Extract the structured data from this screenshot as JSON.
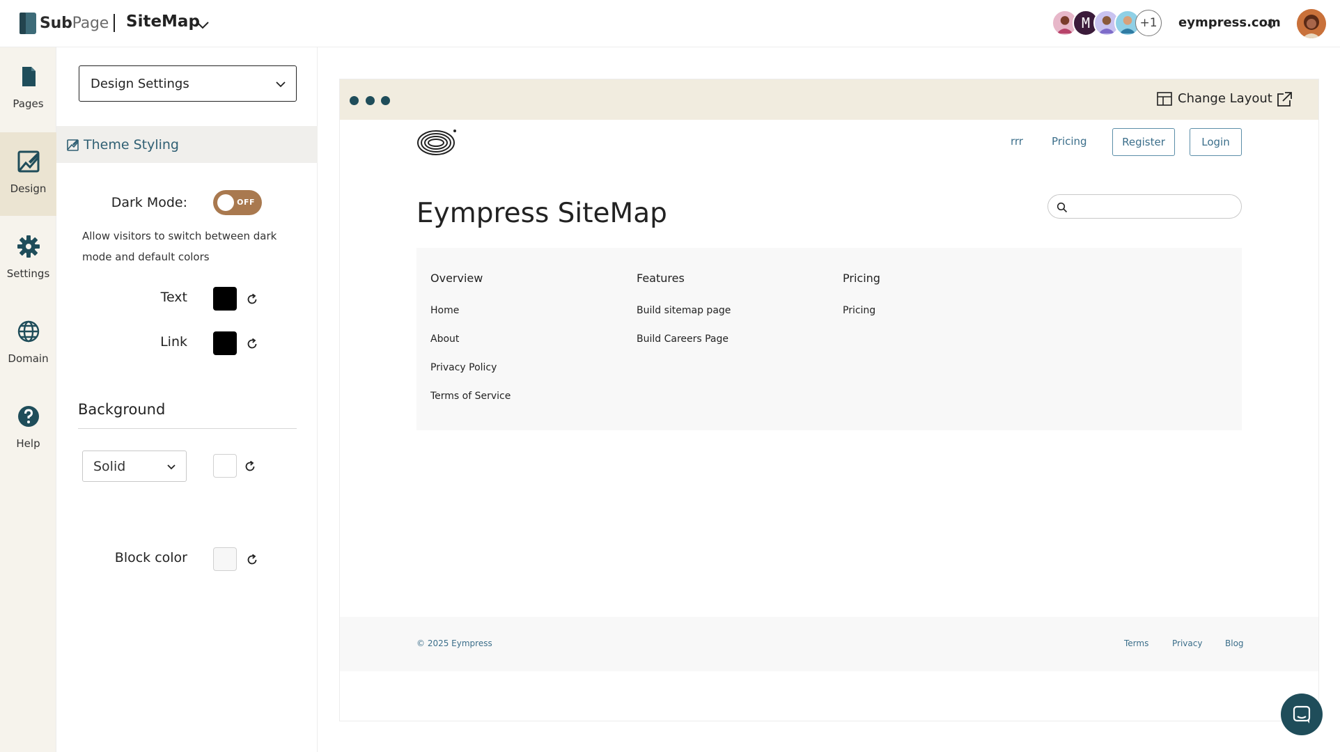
{
  "header": {
    "brand_bold": "Sub",
    "brand_rest": "Page",
    "site_name": "SiteMap",
    "avatars_more": "+1",
    "avatar_m_letter": "M",
    "domain": "eympress.com"
  },
  "leftnav": {
    "items": [
      {
        "label": "Pages",
        "icon": "page-icon"
      },
      {
        "label": "Design",
        "icon": "design-icon"
      },
      {
        "label": "Settings",
        "icon": "gear-icon"
      },
      {
        "label": "Domain",
        "icon": "globe-icon"
      },
      {
        "label": "Help",
        "icon": "help-icon"
      }
    ],
    "active": "Design"
  },
  "panel": {
    "select_value": "Design Settings",
    "section_title": "Theme Styling",
    "dark_mode_label": "Dark Mode:",
    "dark_mode_state": "OFF",
    "dark_mode_help": "Allow visitors to switch between dark mode and default colors",
    "text_label": "Text",
    "text_color": "#000000",
    "link_label": "Link",
    "link_color": "#000000",
    "background_heading": "Background",
    "background_type": "Solid",
    "background_color": "#ffffff",
    "block_color_label": "Block color",
    "block_color": "#f7f7f7"
  },
  "preview": {
    "change_layout": "Change Layout",
    "site": {
      "nav": [
        "rrr",
        "Pricing"
      ],
      "register": "Register",
      "login": "Login",
      "title": "Eympress SiteMap",
      "columns": [
        {
          "title": "Overview",
          "links": [
            "Home",
            "About",
            "Privacy Policy",
            "Terms of Service"
          ]
        },
        {
          "title": "Features",
          "links": [
            "Build sitemap page",
            "Build Careers Page"
          ]
        },
        {
          "title": "Pricing",
          "links": [
            "Pricing"
          ]
        }
      ],
      "footer": {
        "copyright": "© 2025 Eympress",
        "links": [
          "Terms",
          "Privacy",
          "Blog"
        ]
      }
    }
  },
  "colors": {
    "accent": "#1f4d5a",
    "toggle": "#a9794f",
    "link": "#3b6e8a",
    "nav_bg": "#f6f3ec",
    "nav_active": "#ebe4d2"
  }
}
